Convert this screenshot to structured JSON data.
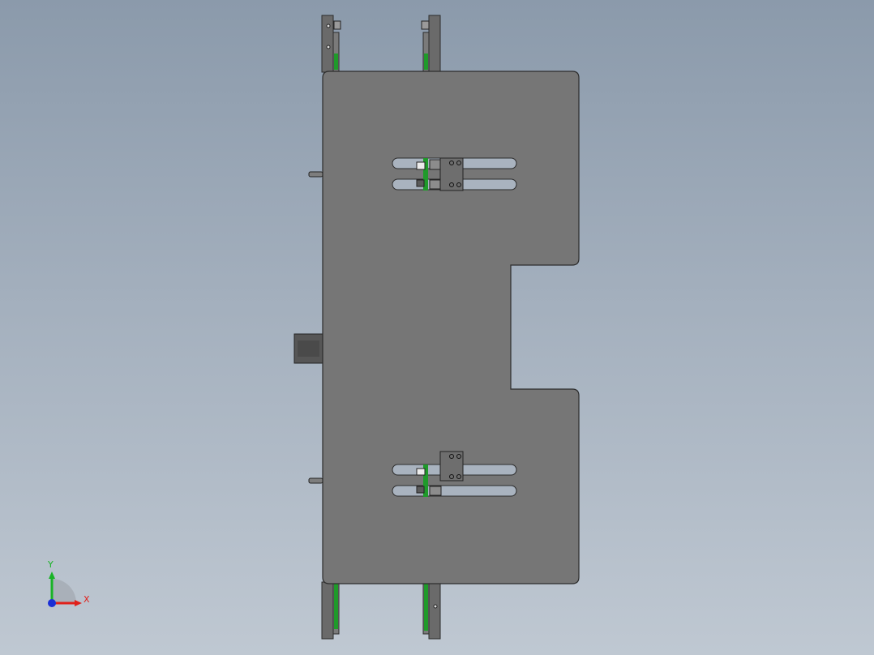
{
  "viewport": {
    "background_top": "#8b9aab",
    "background_bottom": "#bfc8d2"
  },
  "model": {
    "plate_color": "#767676",
    "edge_color": "#2c2c2c",
    "rail_color": "#6a6a6a",
    "belt_color": "#1f9a2a",
    "slot_color": "#a9b3bf"
  },
  "triad": {
    "x_label": "X",
    "y_label": "Y",
    "x_color": "#e0201a",
    "y_color": "#19b326",
    "z_color": "#1a2fd6"
  }
}
